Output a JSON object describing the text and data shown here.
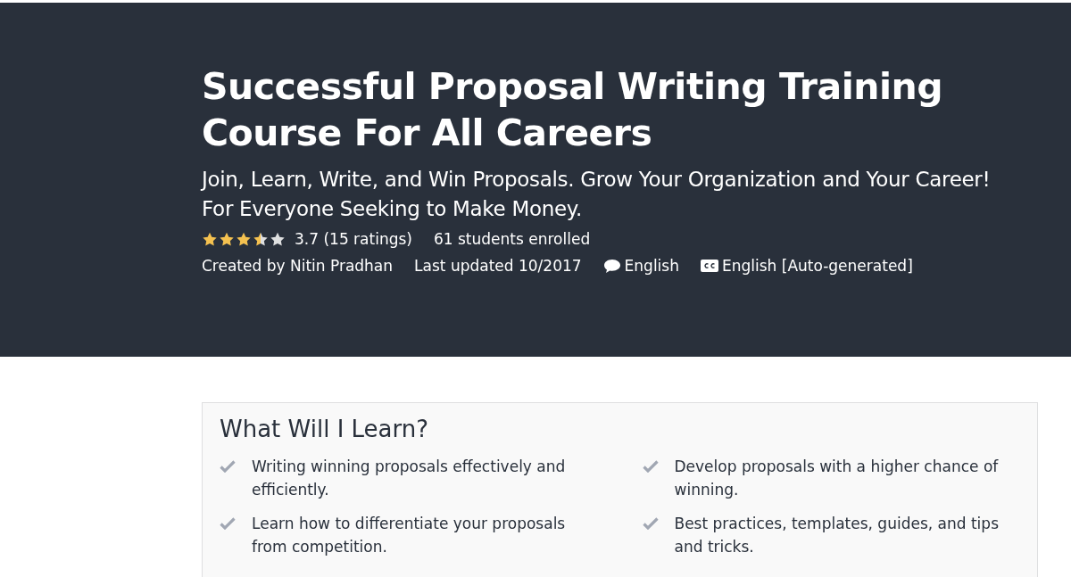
{
  "header": {
    "title": "Successful Proposal Writing Training Course For All Careers",
    "subtitle": "Join, Learn, Write, and Win Proposals. Grow Your Organization and Your Career! For Everyone Seeking to Make Money.",
    "rating": {
      "stars": 3.5,
      "text": "3.7 (15 ratings)"
    },
    "enrolled": "61 students enrolled",
    "created_by": "Created by Nitin Pradhan",
    "last_updated": "Last updated 10/2017",
    "language": "English",
    "captions": "English [Auto-generated]"
  },
  "learn": {
    "title": "What Will I Learn?",
    "items": [
      "Writing winning proposals effectively and efficiently.",
      "Develop proposals with a higher chance of winning.",
      "Learn how to differentiate your proposals from competition.",
      "Best practices, templates, guides, and tips and tricks."
    ]
  }
}
